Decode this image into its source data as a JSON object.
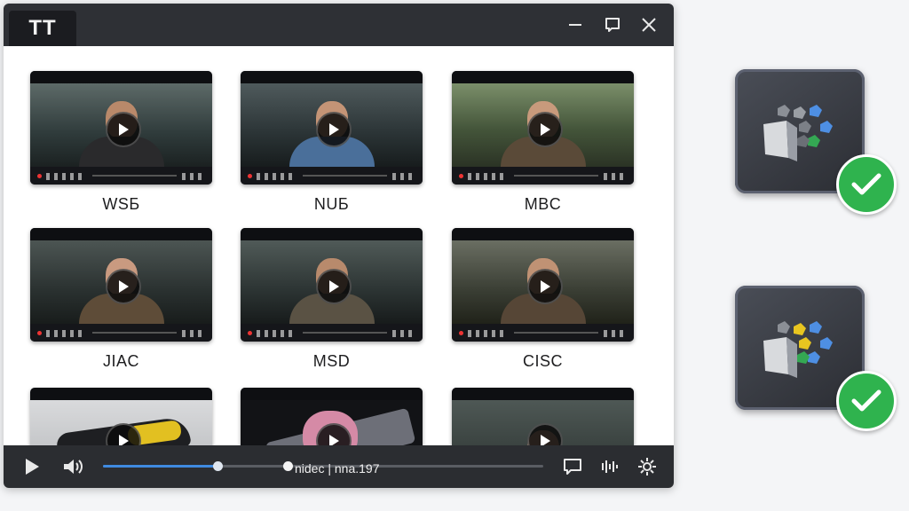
{
  "window": {
    "tab_title": "TT",
    "icons": [
      "minimize-icon",
      "restore-icon",
      "close-icon"
    ]
  },
  "grid": {
    "items": [
      {
        "caption": "WSБ"
      },
      {
        "caption": "NUБ"
      },
      {
        "caption": "MBC"
      },
      {
        "caption": "JIAC"
      },
      {
        "caption": "MSD"
      },
      {
        "caption": "CISC"
      },
      {
        "caption": ""
      },
      {
        "caption": ""
      },
      {
        "caption": ""
      }
    ]
  },
  "player": {
    "label": "nidec | nna.197",
    "progress": 0.26,
    "hover_position": 0.42,
    "icons": [
      "play-icon",
      "volume-icon",
      "subtitles-icon",
      "audio-icon",
      "settings-icon"
    ]
  },
  "app_tiles": [
    {
      "icon": "app-blocks-icon",
      "status": "check-icon"
    },
    {
      "icon": "app-blocks-icon",
      "status": "check-icon"
    }
  ],
  "colors": {
    "titlebar": "#2e3035",
    "player_bar": "#2b2d31",
    "progress": "#3f8ae0",
    "check": "#2fb34e"
  }
}
